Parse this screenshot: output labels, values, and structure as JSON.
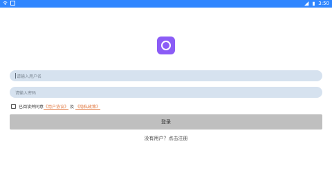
{
  "status": {
    "time": "3:50",
    "icons": [
      "wifi-icon",
      "notification-icon",
      "signal-icon",
      "battery-icon"
    ]
  },
  "login": {
    "username_placeholder": "请输入用户名",
    "password_placeholder": "请输入密码",
    "agree_prefix": "已阅读并同意",
    "user_agreement": "《用户协议》",
    "and": "及",
    "privacy_policy": "《隐私政策》",
    "login_label": "登录",
    "register_prompt": "没有用户？点击注册"
  },
  "colors": {
    "status_bar": "#2f86ff",
    "logo": "#8b5cf6",
    "field": "#d6e2ef",
    "button": "#bfbfbf",
    "link": "#e0763d"
  }
}
